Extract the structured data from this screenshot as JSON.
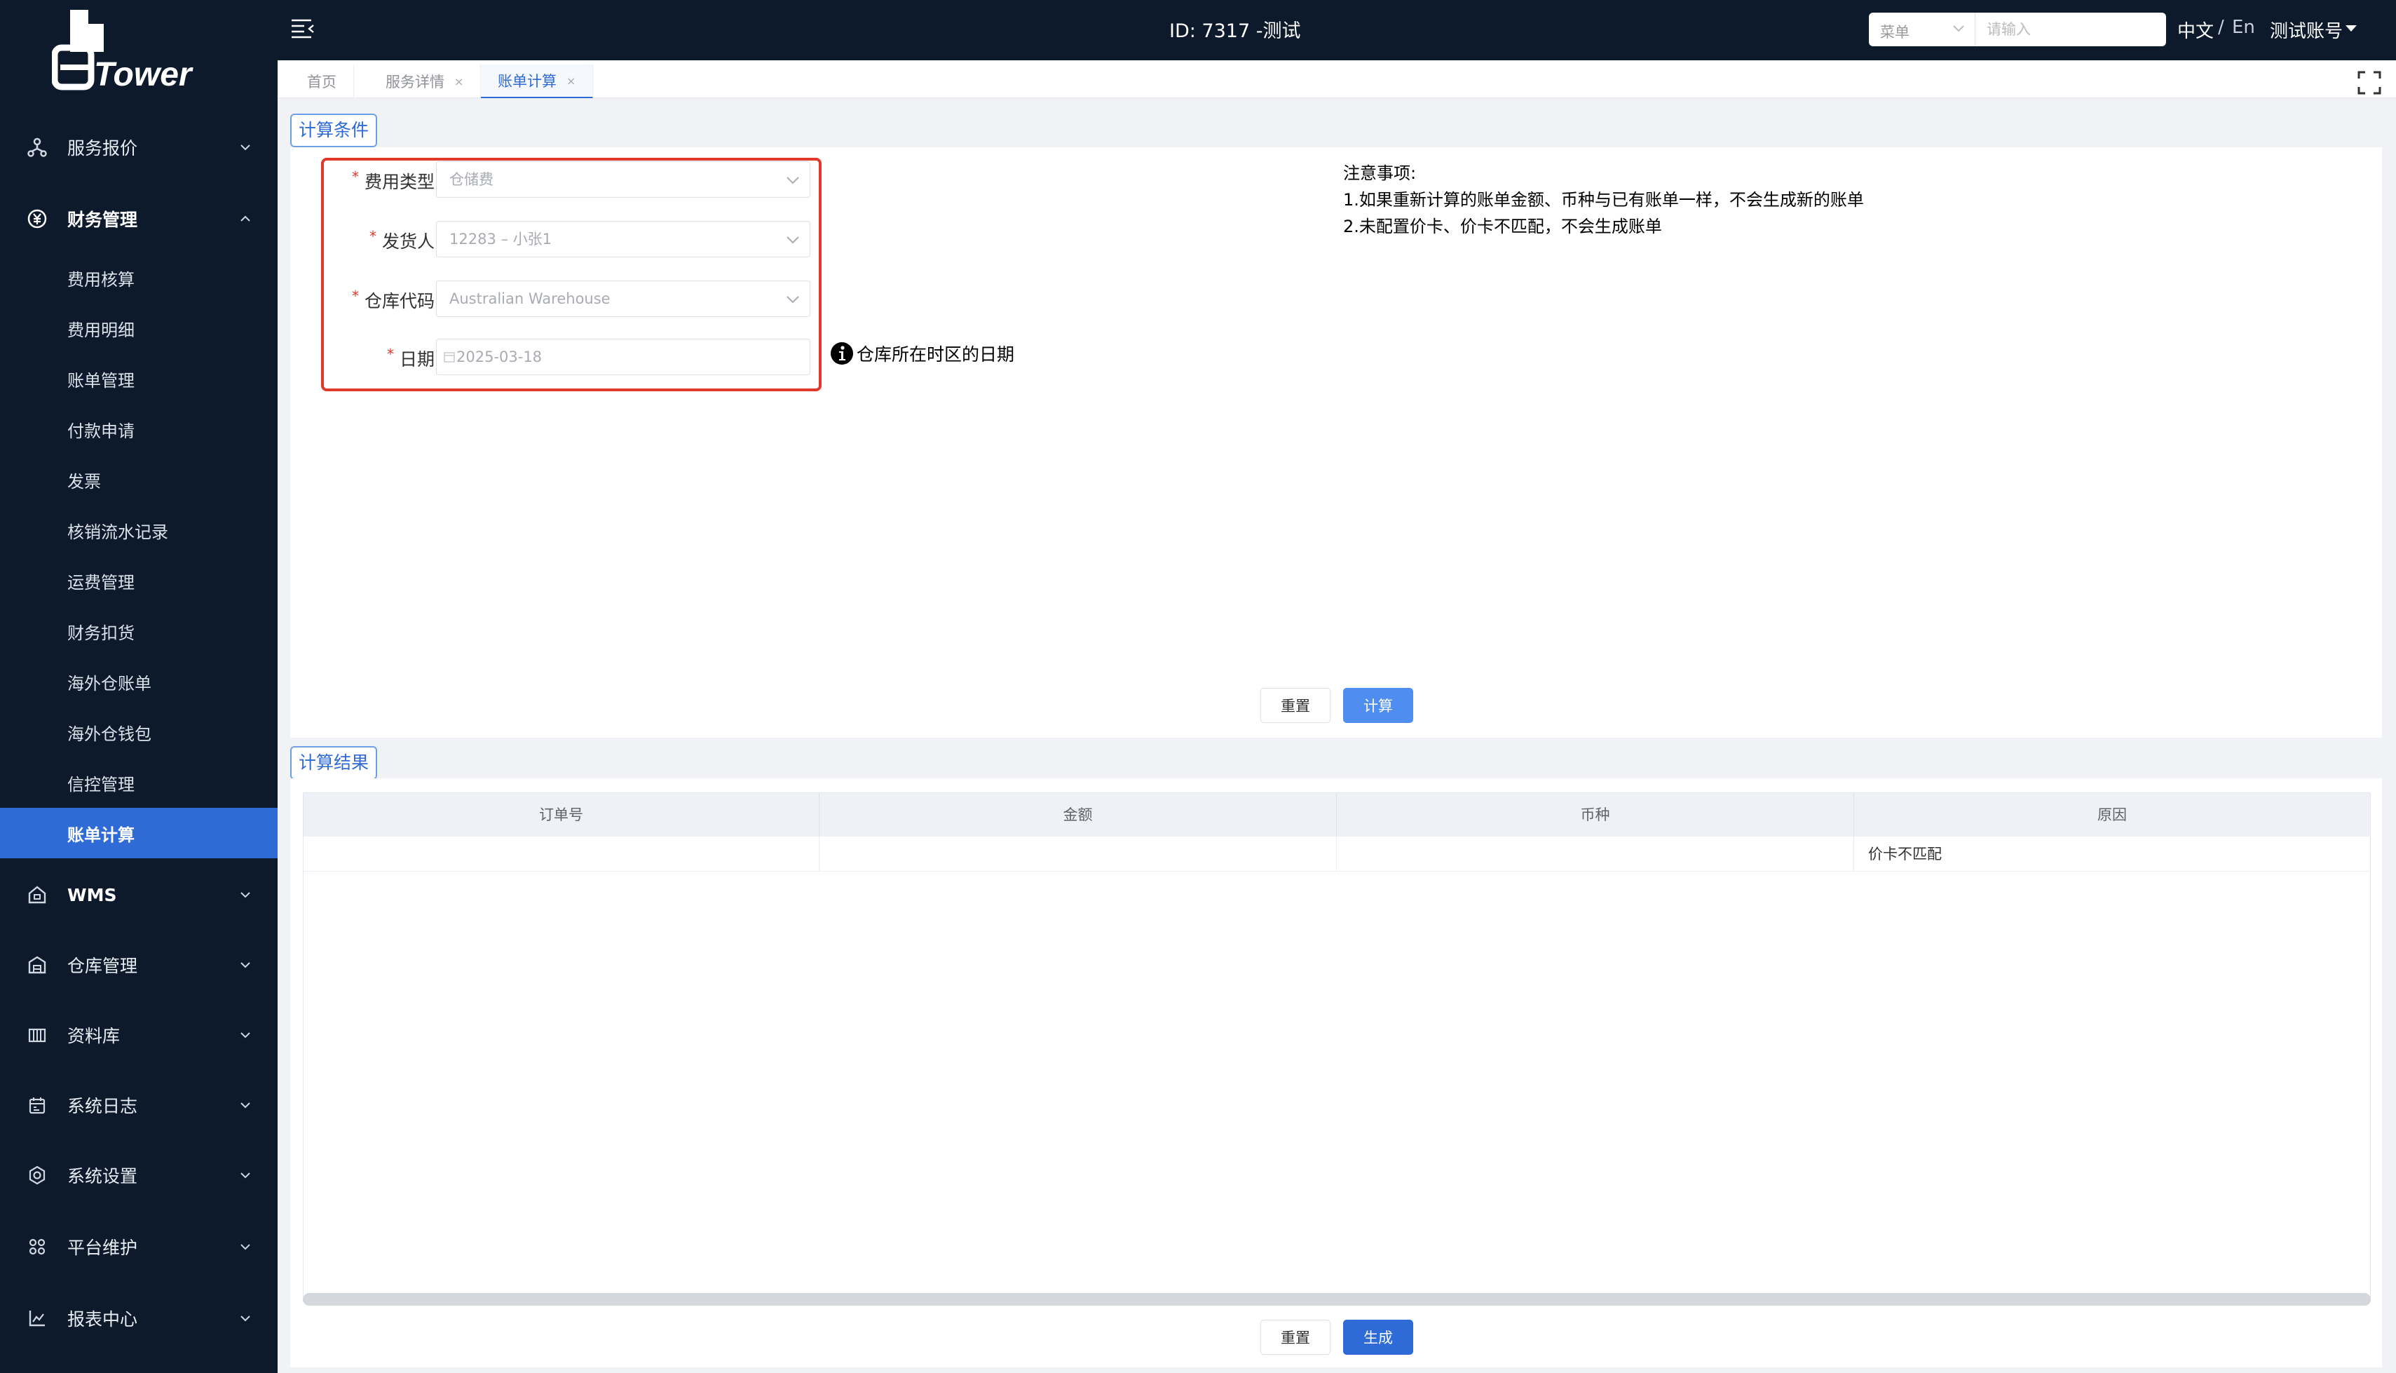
{
  "app": {
    "logo_text": "eTower",
    "header_title": "ID: 7317 -测试",
    "menu_select_label": "菜单",
    "search_placeholder": "请输入",
    "lang_cn": "中文",
    "lang_sep": "/",
    "lang_en": "En",
    "account": "测试账号"
  },
  "sidebar": {
    "groups": [
      {
        "label": "服务报价",
        "icon": "network-icon"
      },
      {
        "label": "财务管理",
        "icon": "yen-circle-icon"
      },
      {
        "label": "WMS",
        "icon": "warehouse-icon"
      },
      {
        "label": "仓库管理",
        "icon": "building-icon"
      },
      {
        "label": "资料库",
        "icon": "database-icon"
      },
      {
        "label": "系统日志",
        "icon": "calendar-icon"
      },
      {
        "label": "系统设置",
        "icon": "gear-icon"
      },
      {
        "label": "平台维护",
        "icon": "apps-icon"
      },
      {
        "label": "报表中心",
        "icon": "chart-icon"
      }
    ],
    "finance_items": [
      "费用核算",
      "费用明细",
      "账单管理",
      "付款申请",
      "发票",
      "核销流水记录",
      "运费管理",
      "财务扣货",
      "海外仓账单",
      "海外仓钱包",
      "信控管理",
      "账单计算"
    ]
  },
  "tabs": [
    {
      "label": "首页"
    },
    {
      "label": "服务详情",
      "close": "×"
    },
    {
      "label": "账单计算",
      "close": "×"
    }
  ],
  "conditions": {
    "section_label": "计算条件",
    "fee_type": {
      "label": "费用类型",
      "value": "仓储费"
    },
    "shipper": {
      "label": "发货人",
      "value": "12283 – 小张1"
    },
    "warehouse": {
      "label": "仓库代码",
      "value": "Australian Warehouse"
    },
    "date": {
      "label": "日期",
      "value": "2025-03-18"
    },
    "required_mark": "*",
    "tz_hint": "仓库所在时区的日期",
    "notice_title": "注意事项:",
    "notice_1": "1.如果重新计算的账单金额、币种与已有账单一样，不会生成新的账单",
    "notice_2": "2.未配置价卡、价卡不匹配，不会生成账单",
    "reset_label": "重置",
    "calc_label": "计算"
  },
  "results": {
    "section_label": "计算结果",
    "columns": [
      "订单号",
      "金额",
      "币种",
      "原因"
    ],
    "rows": [
      {
        "order_no": "",
        "amount": "",
        "currency": "",
        "reason": "价卡不匹配"
      }
    ],
    "reset_label": "重置",
    "generate_label": "生成"
  },
  "colors": {
    "sidebar_bg": "#0c1a2c",
    "accent": "#2e6bd7",
    "highlight_border": "#e0392b"
  }
}
